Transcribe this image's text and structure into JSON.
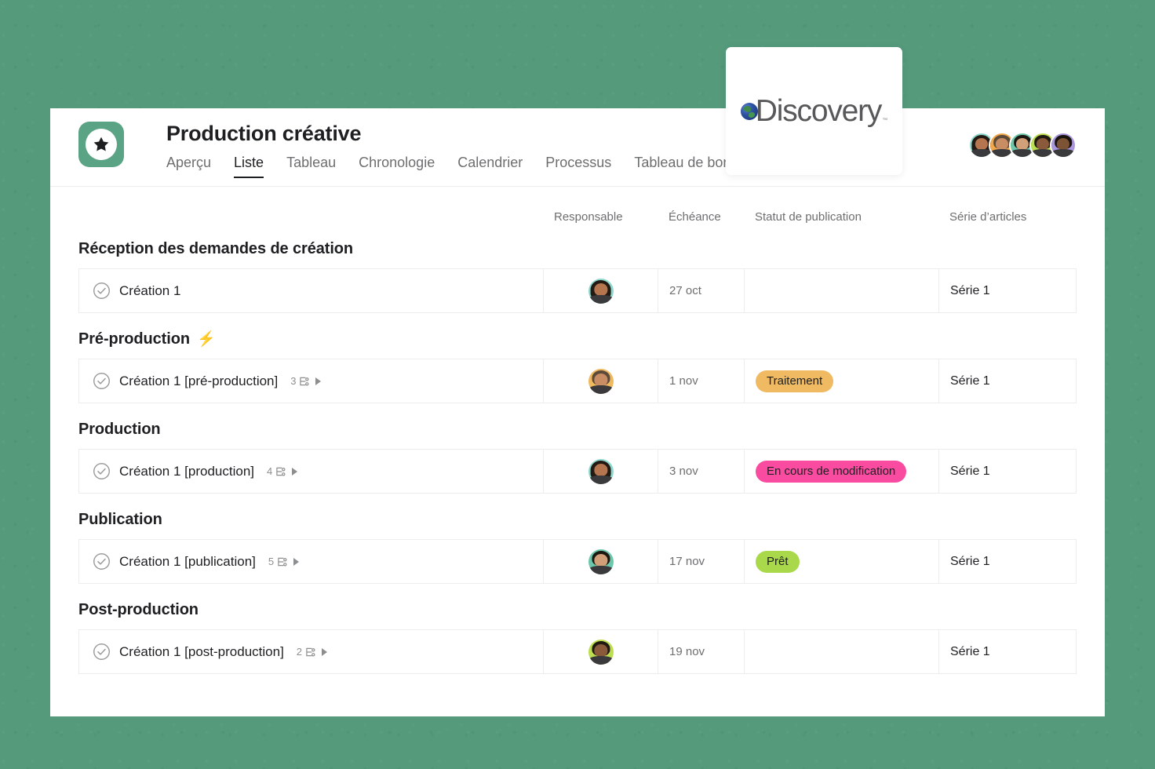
{
  "theme": {
    "background_color": "#549a7b",
    "card_color": "#ffffff",
    "accent_color": "#5aa384",
    "text_primary": "#1e1f21",
    "text_secondary": "#6d6e6f",
    "border_color": "#ededed"
  },
  "header": {
    "project_title": "Production créative",
    "project_icon": "star-icon",
    "tabs": [
      {
        "label": "Aperçu",
        "active": false
      },
      {
        "label": "Liste",
        "active": true
      },
      {
        "label": "Tableau",
        "active": false
      },
      {
        "label": "Chronologie",
        "active": false
      },
      {
        "label": "Calendrier",
        "active": false
      },
      {
        "label": "Processus",
        "active": false
      },
      {
        "label": "Tableau de bord",
        "active": false
      }
    ],
    "members": [
      {
        "name": "avatar-member-1",
        "bg": "#8fd8cd",
        "hair": "#241a14",
        "skin": "#b5764f",
        "long": true
      },
      {
        "name": "avatar-member-2",
        "bg": "#f0a84a",
        "hair": "#5c4a3a",
        "skin": "#c98d63",
        "long": false
      },
      {
        "name": "avatar-member-3",
        "bg": "#6dc8ab",
        "hair": "#1d1712",
        "skin": "#d2a078",
        "long": false
      },
      {
        "name": "avatar-member-4",
        "bg": "#bede52",
        "hair": "#211a12",
        "skin": "#8a5a3b",
        "long": false
      },
      {
        "name": "avatar-member-5",
        "bg": "#a996dd",
        "hair": "#19130e",
        "skin": "#7d5335",
        "long": false
      }
    ]
  },
  "columns": [
    {
      "key": "name",
      "label": ""
    },
    {
      "key": "owner",
      "label": "Responsable"
    },
    {
      "key": "due",
      "label": "Échéance"
    },
    {
      "key": "status",
      "label": "Statut de publication"
    },
    {
      "key": "series",
      "label": "Série d’articles"
    }
  ],
  "badge_colors": {
    "Traitement": {
      "bg": "#f0ba63",
      "fg": "#1e1f21"
    },
    "En cours de modification": {
      "bg": "#f94ba0",
      "fg": "#1e1f21"
    },
    "Prêt": {
      "bg": "#a9d94b",
      "fg": "#1e1f21"
    }
  },
  "sections": [
    {
      "title": "Réception des demandes de création",
      "emoji": "",
      "rows": [
        {
          "task": "Création 1",
          "subtask_count": "",
          "owner_avatar": {
            "bg": "#8fd8cd",
            "hair": "#241a14",
            "skin": "#b5764f",
            "long": true
          },
          "due": "27 oct",
          "status": "",
          "series": "Série 1"
        }
      ]
    },
    {
      "title": "Pré-production",
      "emoji": "⚡",
      "rows": [
        {
          "task": "Création 1 [pré-production]",
          "subtask_count": "3",
          "owner_avatar": {
            "bg": "#f0b95f",
            "hair": "#5c4a3a",
            "skin": "#c98d63",
            "long": false
          },
          "due": "1 nov",
          "status": "Traitement",
          "series": "Série 1"
        }
      ]
    },
    {
      "title": "Production",
      "emoji": "",
      "rows": [
        {
          "task": "Création 1 [production]",
          "subtask_count": "4",
          "owner_avatar": {
            "bg": "#8fd8cd",
            "hair": "#241a14",
            "skin": "#b5764f",
            "long": true
          },
          "due": "3 nov",
          "status": "En cours de modification",
          "series": "Série 1"
        }
      ]
    },
    {
      "title": "Publication",
      "emoji": "",
      "rows": [
        {
          "task": "Création 1 [publication]",
          "subtask_count": "5",
          "owner_avatar": {
            "bg": "#6dc8ab",
            "hair": "#1d1712",
            "skin": "#d2a078",
            "long": false
          },
          "due": "17 nov",
          "status": "Prêt",
          "series": "Série 1"
        }
      ]
    },
    {
      "title": "Post-production",
      "emoji": "",
      "rows": [
        {
          "task": "Création 1 [post-production]",
          "subtask_count": "2",
          "owner_avatar": {
            "bg": "#bede52",
            "hair": "#211a12",
            "skin": "#8a5a3b",
            "long": false
          },
          "due": "19 nov",
          "status": "",
          "series": "Série 1"
        }
      ]
    }
  ],
  "logo_card": {
    "brand": "Discovery",
    "trademark": "™",
    "icon": "globe-icon"
  }
}
